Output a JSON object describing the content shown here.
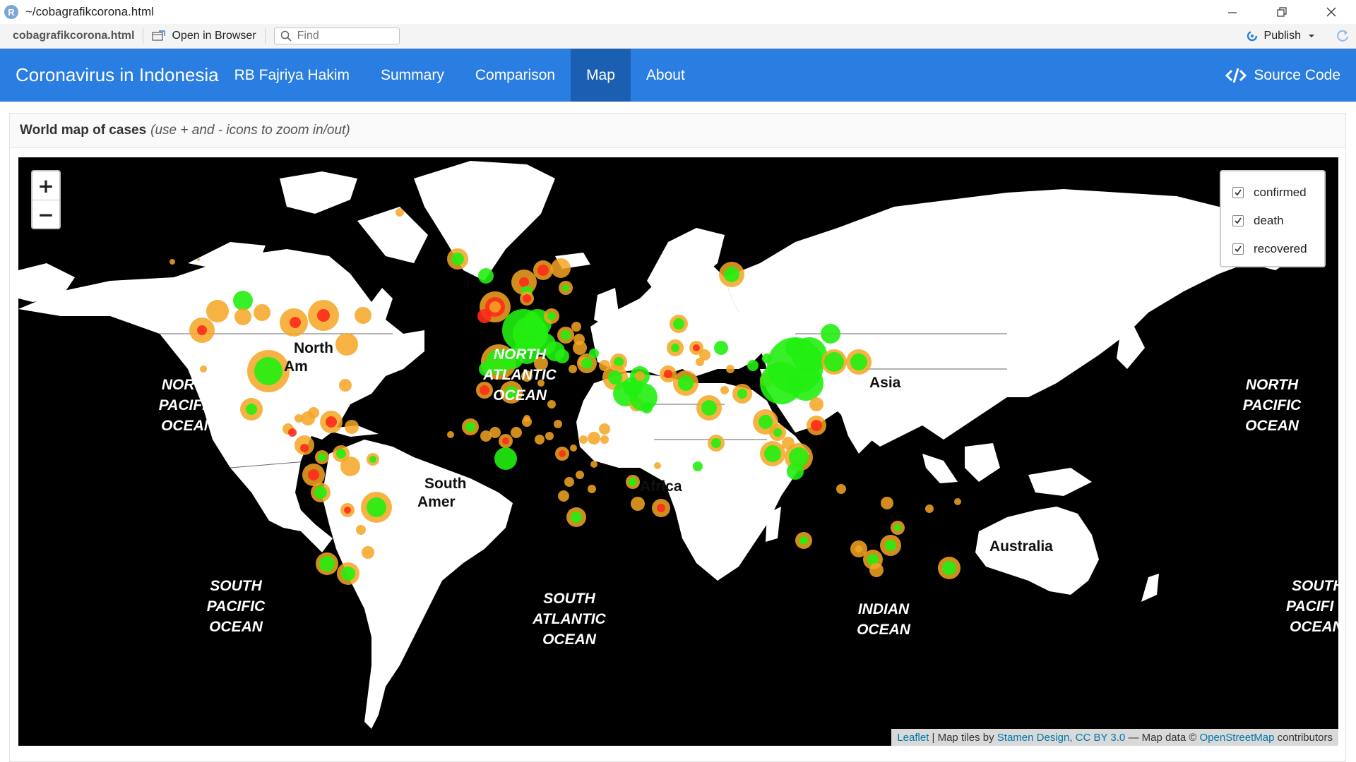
{
  "window": {
    "logo_letter": "R",
    "title": "~/cobagrafikcorona.html"
  },
  "toolbar": {
    "file_name": "cobagrafikcorona.html",
    "open_label": "Open in Browser",
    "find_placeholder": "Find",
    "publish_label": "Publish"
  },
  "navbar": {
    "brand": "Coronavirus in Indonesia",
    "author": "RB Fajriya Hakim",
    "items": [
      {
        "label": "Summary"
      },
      {
        "label": "Comparison"
      },
      {
        "label": "Map"
      },
      {
        "label": "About"
      }
    ],
    "source_label": "Source Code"
  },
  "card": {
    "title": "World map of cases",
    "subtitle": "(use + and - icons to zoom in/out)"
  },
  "map": {
    "zoom_in": "+",
    "zoom_out": "−",
    "layers": [
      {
        "label": "confirmed",
        "checked": true
      },
      {
        "label": "death",
        "checked": true
      },
      {
        "label": "recovered",
        "checked": true
      }
    ],
    "labels": {
      "north_america_1": "North",
      "north_america_2": "Am",
      "south_america_1": "South",
      "south_america_2": "Amer",
      "africa": "Africa",
      "asia": "Asia",
      "australia": "Australia",
      "npo_w_1": "NORTH",
      "npo_w_2": "PACIFIC",
      "npo_w_3": "OCEAN",
      "nao_1": "NORTH",
      "nao_2": "ATLANTIC",
      "nao_3": "OCEAN",
      "npo_e_1": "NORTH",
      "npo_e_2": "PACIFIC",
      "npo_e_3": "OCEAN",
      "spo_w_1": "SOUTH",
      "spo_w_2": "PACIFIC",
      "spo_w_3": "OCEAN",
      "sao_1": "SOUTH",
      "sao_2": "ATLANTIC",
      "sao_3": "OCEAN",
      "io_1": "INDIAN",
      "io_2": "OCEAN",
      "spo_e_1": "SOUTH",
      "spo_e_2": "PACIFI",
      "spo_e_3": "OCEAN"
    },
    "attribution": {
      "leaflet": "Leaflet",
      "tiles_prefix": " | Map tiles by ",
      "stamen": "Stamen Design, CC BY 3.0",
      "data_prefix": " — Map data © ",
      "osm": "OpenStreetMap",
      "suffix": " contributors"
    },
    "colors": {
      "confirmed": "#f5a623",
      "death": "#ff2a1a",
      "recovered": "#22ee11",
      "land": "#ffffff",
      "water": "#000000"
    }
  }
}
